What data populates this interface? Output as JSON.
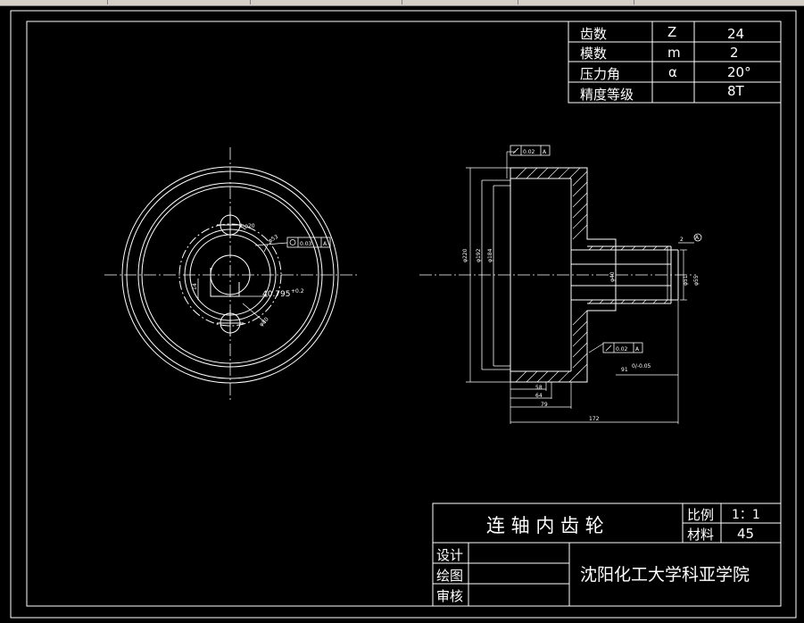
{
  "gear_params": {
    "rows": [
      {
        "name": "齿数",
        "symbol": "Z",
        "value": "24"
      },
      {
        "name": "模数",
        "symbol": "m",
        "value": "2"
      },
      {
        "name": "压力角",
        "symbol": "α",
        "value": "20°"
      },
      {
        "name": "精度等级",
        "symbol": "",
        "value": "8T"
      }
    ]
  },
  "title_block": {
    "part_name": "连 轴 内 齿 轮",
    "scale_label": "比例",
    "scale_value": "1：1",
    "material_label": "材料",
    "material_value": "45",
    "design_label": "设计",
    "drawing_label": "绘图",
    "review_label": "审核",
    "school": "沈阳化工大学科亚学院"
  },
  "front_view": {
    "hole_label": "2-φ20",
    "runout_label": "φ53",
    "tol_value": "0.03",
    "tol_datum": "A",
    "dim_left": "14",
    "dim_bottom": "40.795",
    "dim_bottom_tol": "+0.2",
    "dim_diag": "φ80"
  },
  "side_view": {
    "tol_top_value": "0.02",
    "tol_top_datum": "A",
    "tol_bottom_value": "0.02",
    "tol_bottom_datum": "A",
    "dia_outer": "φ220",
    "dia_192": "φ192",
    "dia_184": "φ184",
    "dia_shaft_inner": "φ40",
    "dia_51": "φ51",
    "dia_55": "φ55",
    "fit_label": "91",
    "fit_tol": "0/-0.05",
    "dim_58": "58",
    "dim_64": "64",
    "dim_79": "79",
    "dim_172": "172",
    "small_dim": "2",
    "datum_marker": "A"
  },
  "colors": {
    "background": "#000000",
    "lines": "#ffffff",
    "toolbar": "#d4d0c8"
  }
}
